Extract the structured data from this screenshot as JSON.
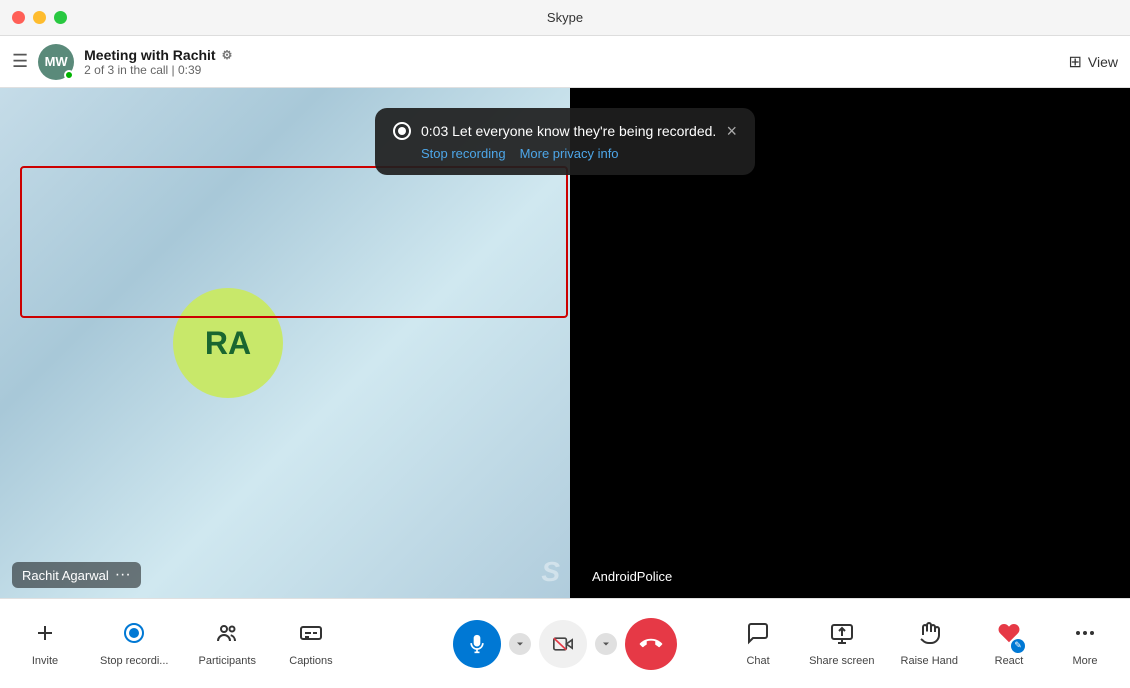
{
  "window": {
    "title": "Skype"
  },
  "titlebar": {
    "buttons": {
      "close": "×",
      "minimize": "−",
      "maximize": "+"
    }
  },
  "header": {
    "avatar_initials": "MW",
    "meeting_title": "Meeting with Rachit",
    "settings_icon": "⚙",
    "call_info": "2 of 3 in the call | 0:39",
    "view_label": "View",
    "view_icon": "⊞"
  },
  "recording_notification": {
    "timer": "0:03",
    "message": "Let everyone know they're being recorded.",
    "stop_recording": "Stop recording",
    "more_privacy": "More privacy info",
    "close": "×"
  },
  "participants": {
    "left": {
      "initials": "RA",
      "name": "Rachit Agarwal",
      "dots": "···"
    },
    "right": {
      "name": "AndroidPolice"
    }
  },
  "toolbar": {
    "invite_label": "Invite",
    "stop_recording_label": "Stop recordi...",
    "participants_label": "Participants",
    "captions_label": "Captions",
    "chat_label": "Chat",
    "share_screen_label": "Share screen",
    "raise_hand_label": "Raise Hand",
    "react_label": "React",
    "more_label": "More",
    "invite_icon": "↑",
    "stop_rec_icon": "⏺",
    "participants_icon": "👥",
    "captions_icon": "⬜",
    "mic_icon": "🎤",
    "cam_icon": "📷",
    "end_icon": "📞",
    "chat_icon": "💬",
    "share_icon": "⬆",
    "raise_hand_icon": "✋",
    "react_icon": "❤",
    "more_icon": "···"
  }
}
